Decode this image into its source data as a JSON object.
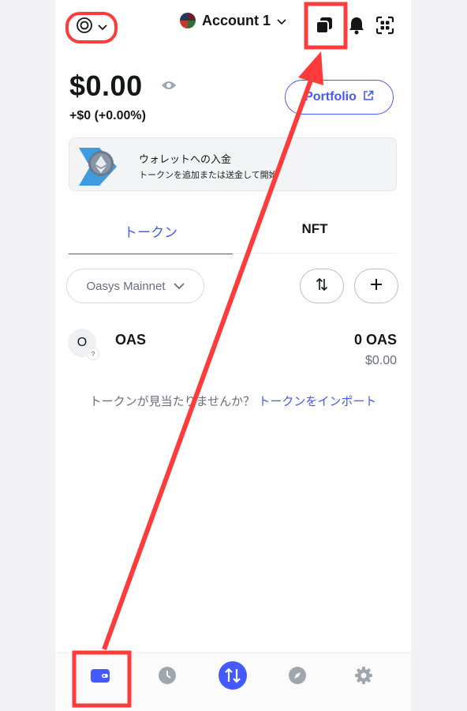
{
  "header": {
    "network_icon": "target-icon",
    "network_chevron": "chevron-down-icon",
    "account_name": "Account 1",
    "account_chevron": "chevron-down-icon",
    "icons": [
      "copy-stack-icon",
      "bell-icon",
      "scan-grid-icon"
    ]
  },
  "balance": {
    "amount": "$0.00",
    "change": "+$0 (+0.00%)",
    "eye_icon": "eye-icon"
  },
  "portfolio_button": {
    "label": "Portfolio",
    "icon": "external-link-icon"
  },
  "banner": {
    "title": "ウォレットへの入金",
    "description": "トークンを追加または送金して開始",
    "icon": "ethereum-coin-icon"
  },
  "tabs": [
    {
      "label": "トークン",
      "active": true
    },
    {
      "label": "NFT",
      "active": false
    }
  ],
  "filter": {
    "network": "Oasys Mainnet",
    "sort_icon": "sort-arrows-icon",
    "add_icon": "plus-icon"
  },
  "tokens": [
    {
      "symbol": "OAS",
      "icon_letter": "O",
      "badge": "?",
      "amount": "0 OAS",
      "fiat": "$0.00"
    }
  ],
  "import": {
    "prompt": "トークンが見当たりませんか？",
    "link": "トークンをインポート"
  },
  "bottom_nav": [
    "wallet-icon",
    "clock-icon",
    "swap-icon",
    "compass-icon",
    "gear-icon"
  ],
  "colors": {
    "accent": "#4459ff",
    "highlight": "#ff3b3b",
    "text": "#141618",
    "muted": "#686e7d"
  }
}
